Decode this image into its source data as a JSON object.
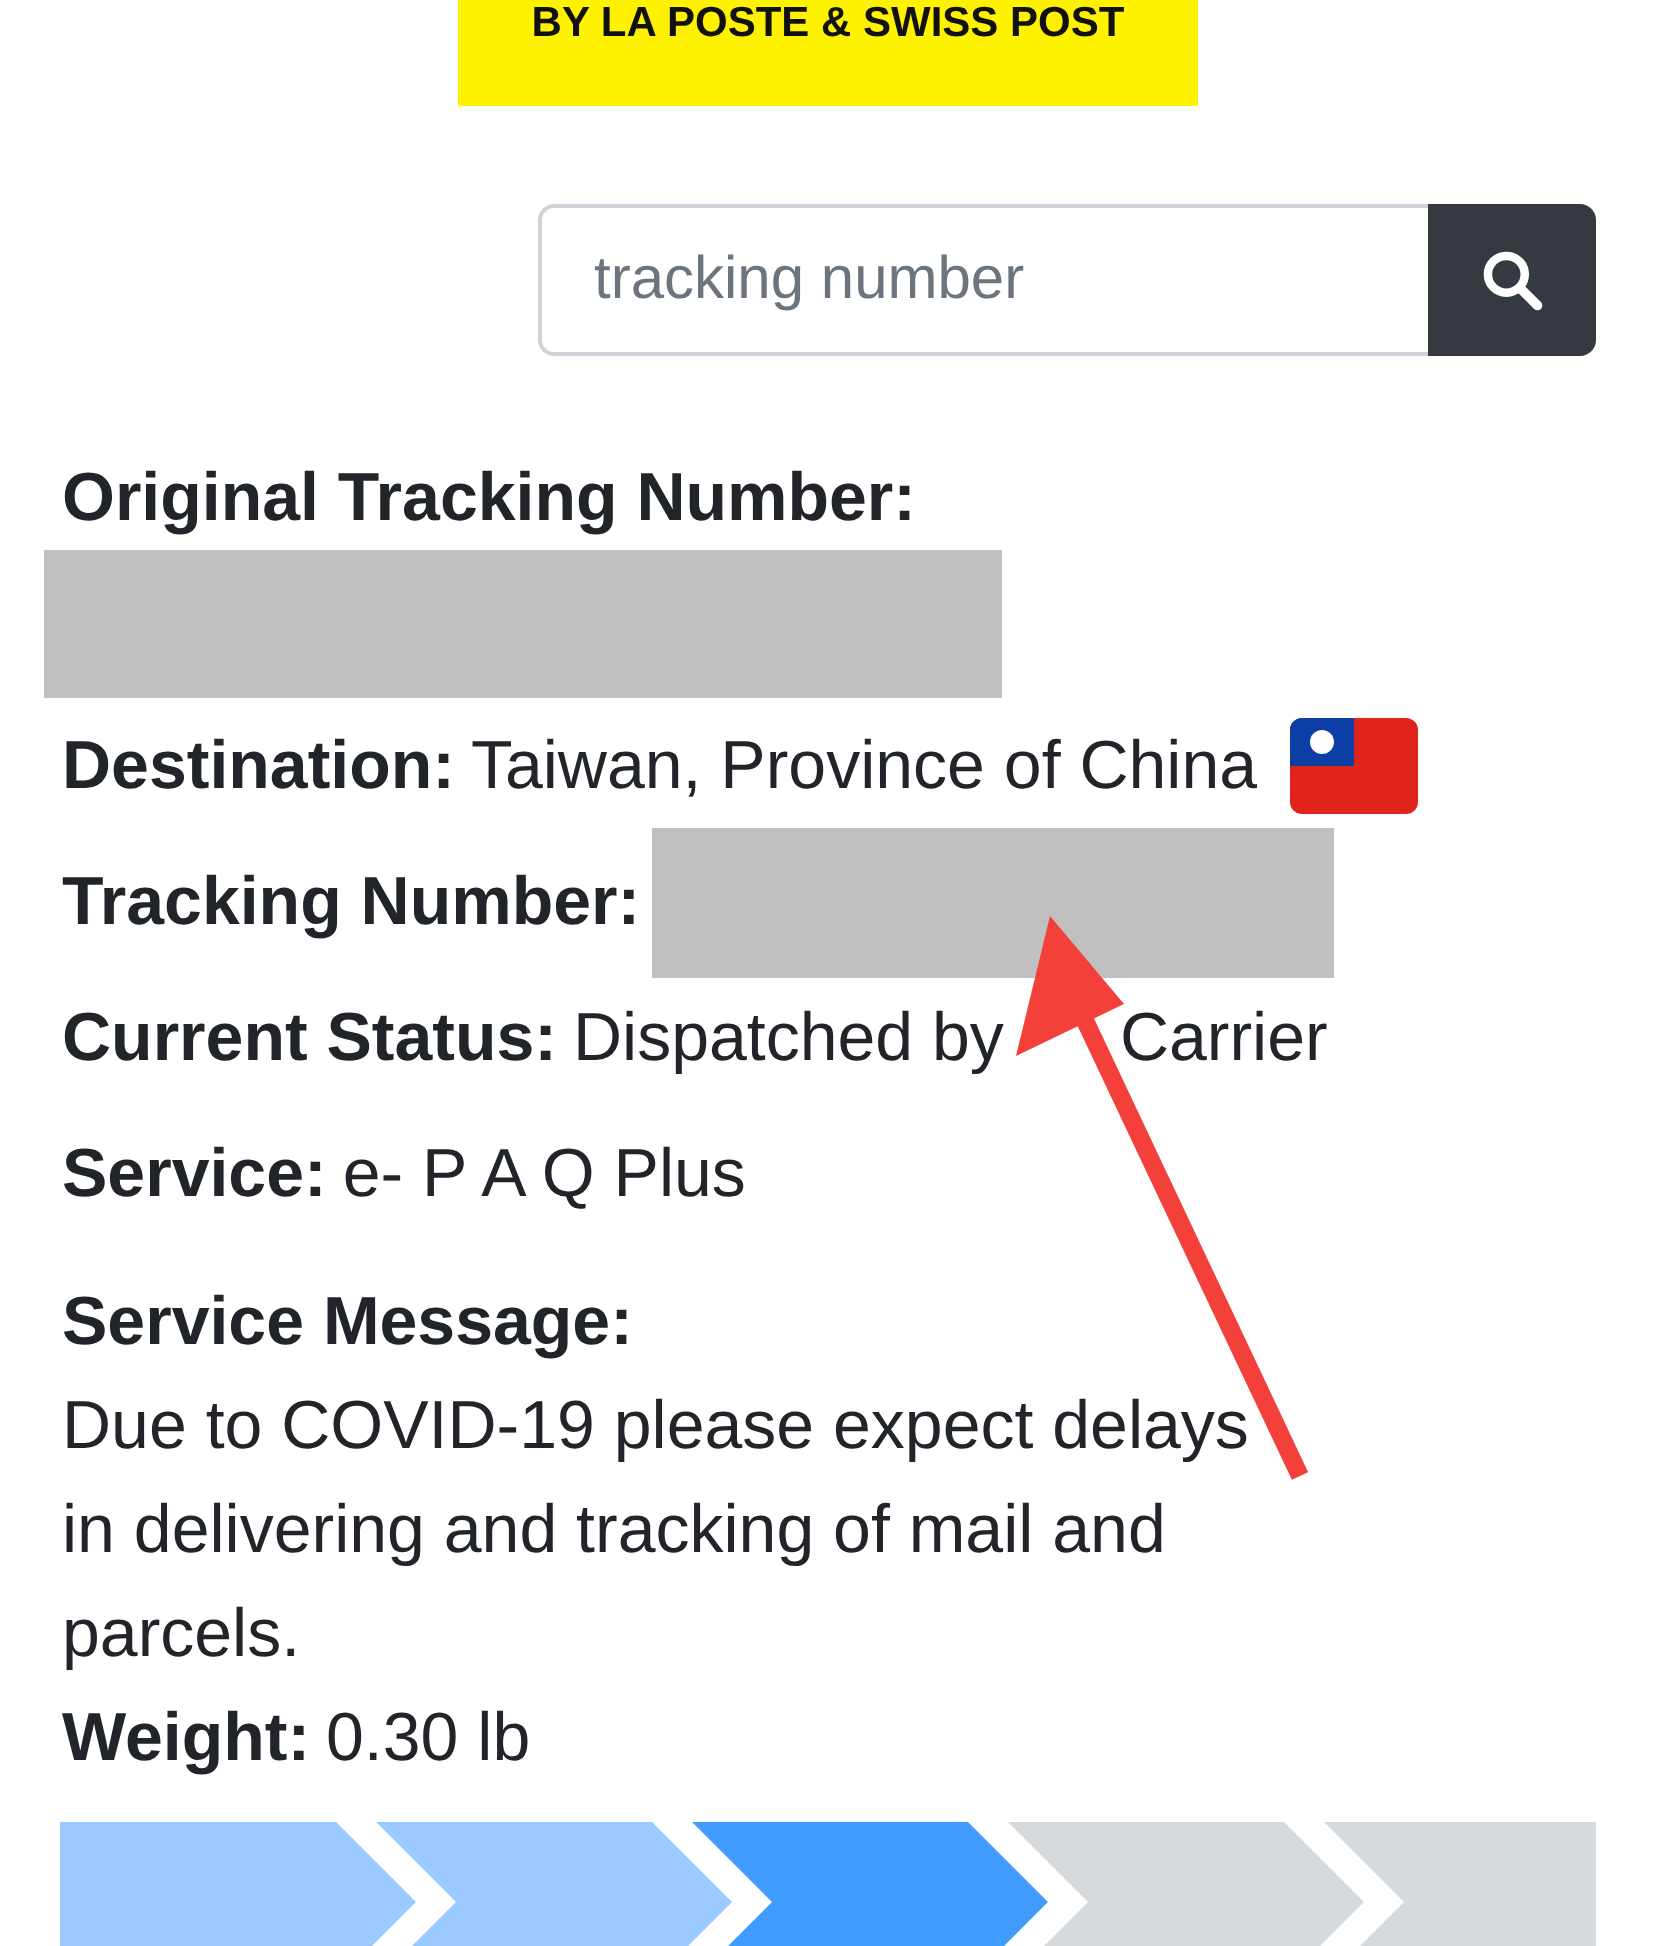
{
  "logo": {
    "text": "BY LA POSTE & SWISS POST"
  },
  "search": {
    "placeholder": "tracking number"
  },
  "details": [
    {
      "kind": "label-block",
      "label": "Original Tracking Number:"
    },
    {
      "kind": "inline-flag",
      "label": "Destination:",
      "value": "Taiwan, Province of China"
    },
    {
      "kind": "inline-redacted",
      "label": "Tracking Number:"
    },
    {
      "kind": "inline-covered",
      "label": "Current Status:",
      "value": "Dispatched by",
      "value_after_cover": "Carrier"
    },
    {
      "kind": "inline",
      "label": "Service:",
      "value": "e- P A Q Plus"
    },
    {
      "kind": "message",
      "label": "Service Message:",
      "value": "Due to COVID-19 please expect delays in delivering and tracking of mail and parcels."
    },
    {
      "kind": "inline",
      "label": "Weight:",
      "value": "0.30 lb"
    }
  ],
  "progress": [
    {
      "color": "#99c9ff"
    },
    {
      "color": "#99c9ff"
    },
    {
      "color": "#409cff"
    },
    {
      "color": "#d7dadd"
    },
    {
      "color": "#d7dadd"
    }
  ]
}
